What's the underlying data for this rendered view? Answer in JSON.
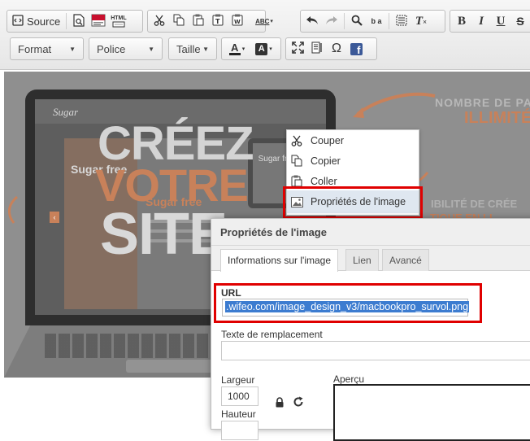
{
  "toolbar": {
    "source_label": "Source",
    "html_icon_text": "HTML",
    "format_label": "Format",
    "font_label": "Police",
    "size_label": "Taille",
    "text_color_letter": "A",
    "bg_color_letter": "A",
    "special_char_symbol": "Ω",
    "social_icon_text": "f",
    "bold_letter": "B",
    "italic_letter": "I",
    "underline_letter": "U",
    "clear_format_letter": "T",
    "spell_letters": "ABC",
    "find_replace_letters": "b a"
  },
  "banner": {
    "logo_text": "Sugar",
    "headline_1": "CRÉEZ",
    "headline_2": "VOTRE",
    "headline_3": "SITE",
    "promo_top": "NOMBRE DE PA",
    "promo_top_highlight": "ILLIMITÉ",
    "promo_mid": "IBILITÉ DE CRÉE",
    "promo_mid_highlight": "TIQUE EN LI",
    "site_heading_1": "Sugar free",
    "site_heading_2": "Sugar free",
    "phone_text": "Sugar free"
  },
  "context_menu": {
    "items": [
      {
        "label": "Couper",
        "icon": "scissors-icon"
      },
      {
        "label": "Copier",
        "icon": "copy-icon"
      },
      {
        "label": "Coller",
        "icon": "paste-icon"
      },
      {
        "label": "Propriétés de l'image",
        "icon": "image-icon"
      }
    ]
  },
  "dialog": {
    "title": "Propriétés de l'image",
    "tabs": [
      "Informations sur l'image",
      "Lien",
      "Avancé"
    ],
    "active_tab": "Informations sur l'image",
    "url_label": "URL",
    "url_value": ".wifeo.com/image_design_v3/macbookpro_survol.png",
    "alt_label": "Texte de remplacement",
    "alt_value": "",
    "width_label": "Largeur",
    "width_value": "1000",
    "height_label": "Hauteur",
    "height_value": "",
    "preview_label": "Aperçu"
  },
  "colors": {
    "highlight_frame": "#e00000",
    "selection_blue": "#3c7cd0",
    "orange_accent": "#c8815a"
  }
}
